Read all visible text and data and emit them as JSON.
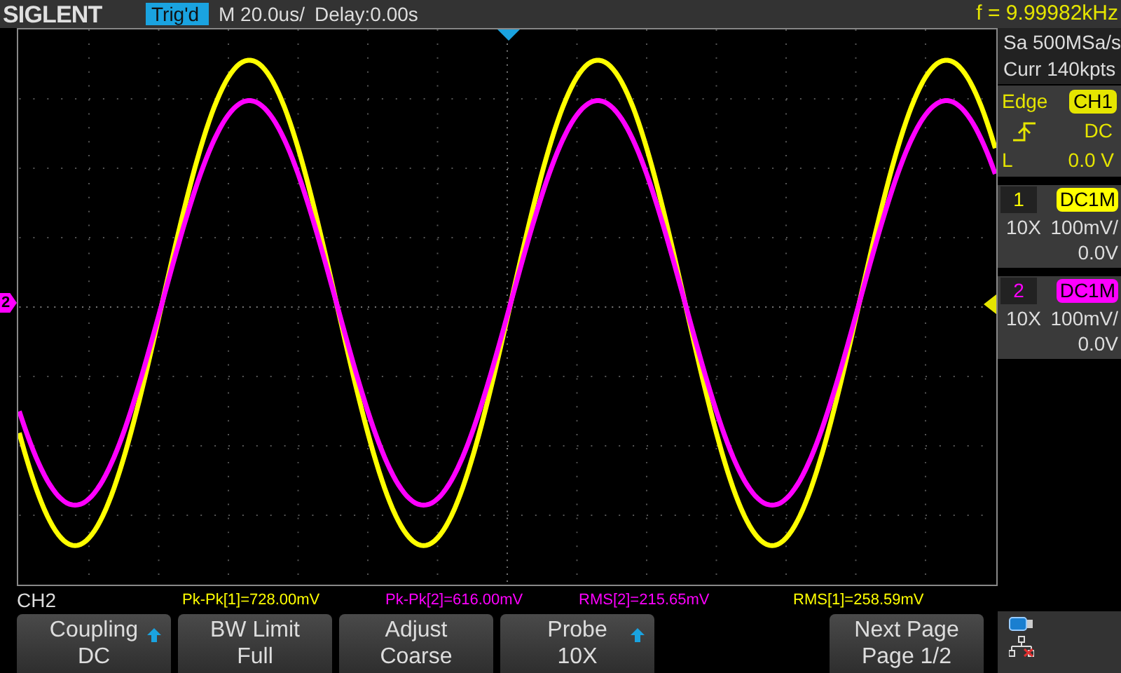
{
  "header": {
    "logo": "SIGLENT",
    "trigger_status": "Trig'd",
    "timebase": "M 20.0us/",
    "delay": "Delay:0.00s",
    "frequency": "f = 9.99982kHz"
  },
  "traces": [
    {
      "color": "#ffff00"
    },
    {
      "color": "#ff00ff"
    }
  ],
  "ground_marker": {
    "label": "2",
    "color": "#ff00ff"
  },
  "right_panel": {
    "sample_rate": "Sa 500MSa/s",
    "memory": "Curr 140kpts",
    "trigger": {
      "type": "Edge",
      "source": "CH1",
      "coupling": "DC",
      "level_label": "L",
      "level": "0.0 V"
    },
    "channels": [
      {
        "number": "1",
        "coupling": "DC1M",
        "probe": "10X",
        "scale": "100mV/",
        "offset": "0.0V",
        "color": "#ffff00"
      },
      {
        "number": "2",
        "coupling": "DC1M",
        "probe": "10X",
        "scale": "100mV/",
        "offset": "0.0V",
        "color": "#ff00ff"
      }
    ]
  },
  "menu_title": "CH2",
  "measurements": [
    {
      "text": "Pk-Pk[1]=728.00mV",
      "color": "#ffff00"
    },
    {
      "text": "Pk-Pk[2]=616.00mV",
      "color": "#ff00ff"
    },
    {
      "text": "RMS[2]=215.65mV",
      "color": "#ff00ff"
    },
    {
      "text": "RMS[1]=258.59mV",
      "color": "#ffff00"
    }
  ],
  "softkeys": [
    {
      "label": "Coupling",
      "value": "DC",
      "arrow": true
    },
    {
      "label": "BW Limit",
      "value": "Full",
      "arrow": false
    },
    {
      "label": "Adjust",
      "value": "Coarse",
      "arrow": false
    },
    {
      "label": "Probe",
      "value": "10X",
      "arrow": true
    },
    {
      "label": "Next Page",
      "value": "Page 1/2",
      "arrow": false
    }
  ]
}
